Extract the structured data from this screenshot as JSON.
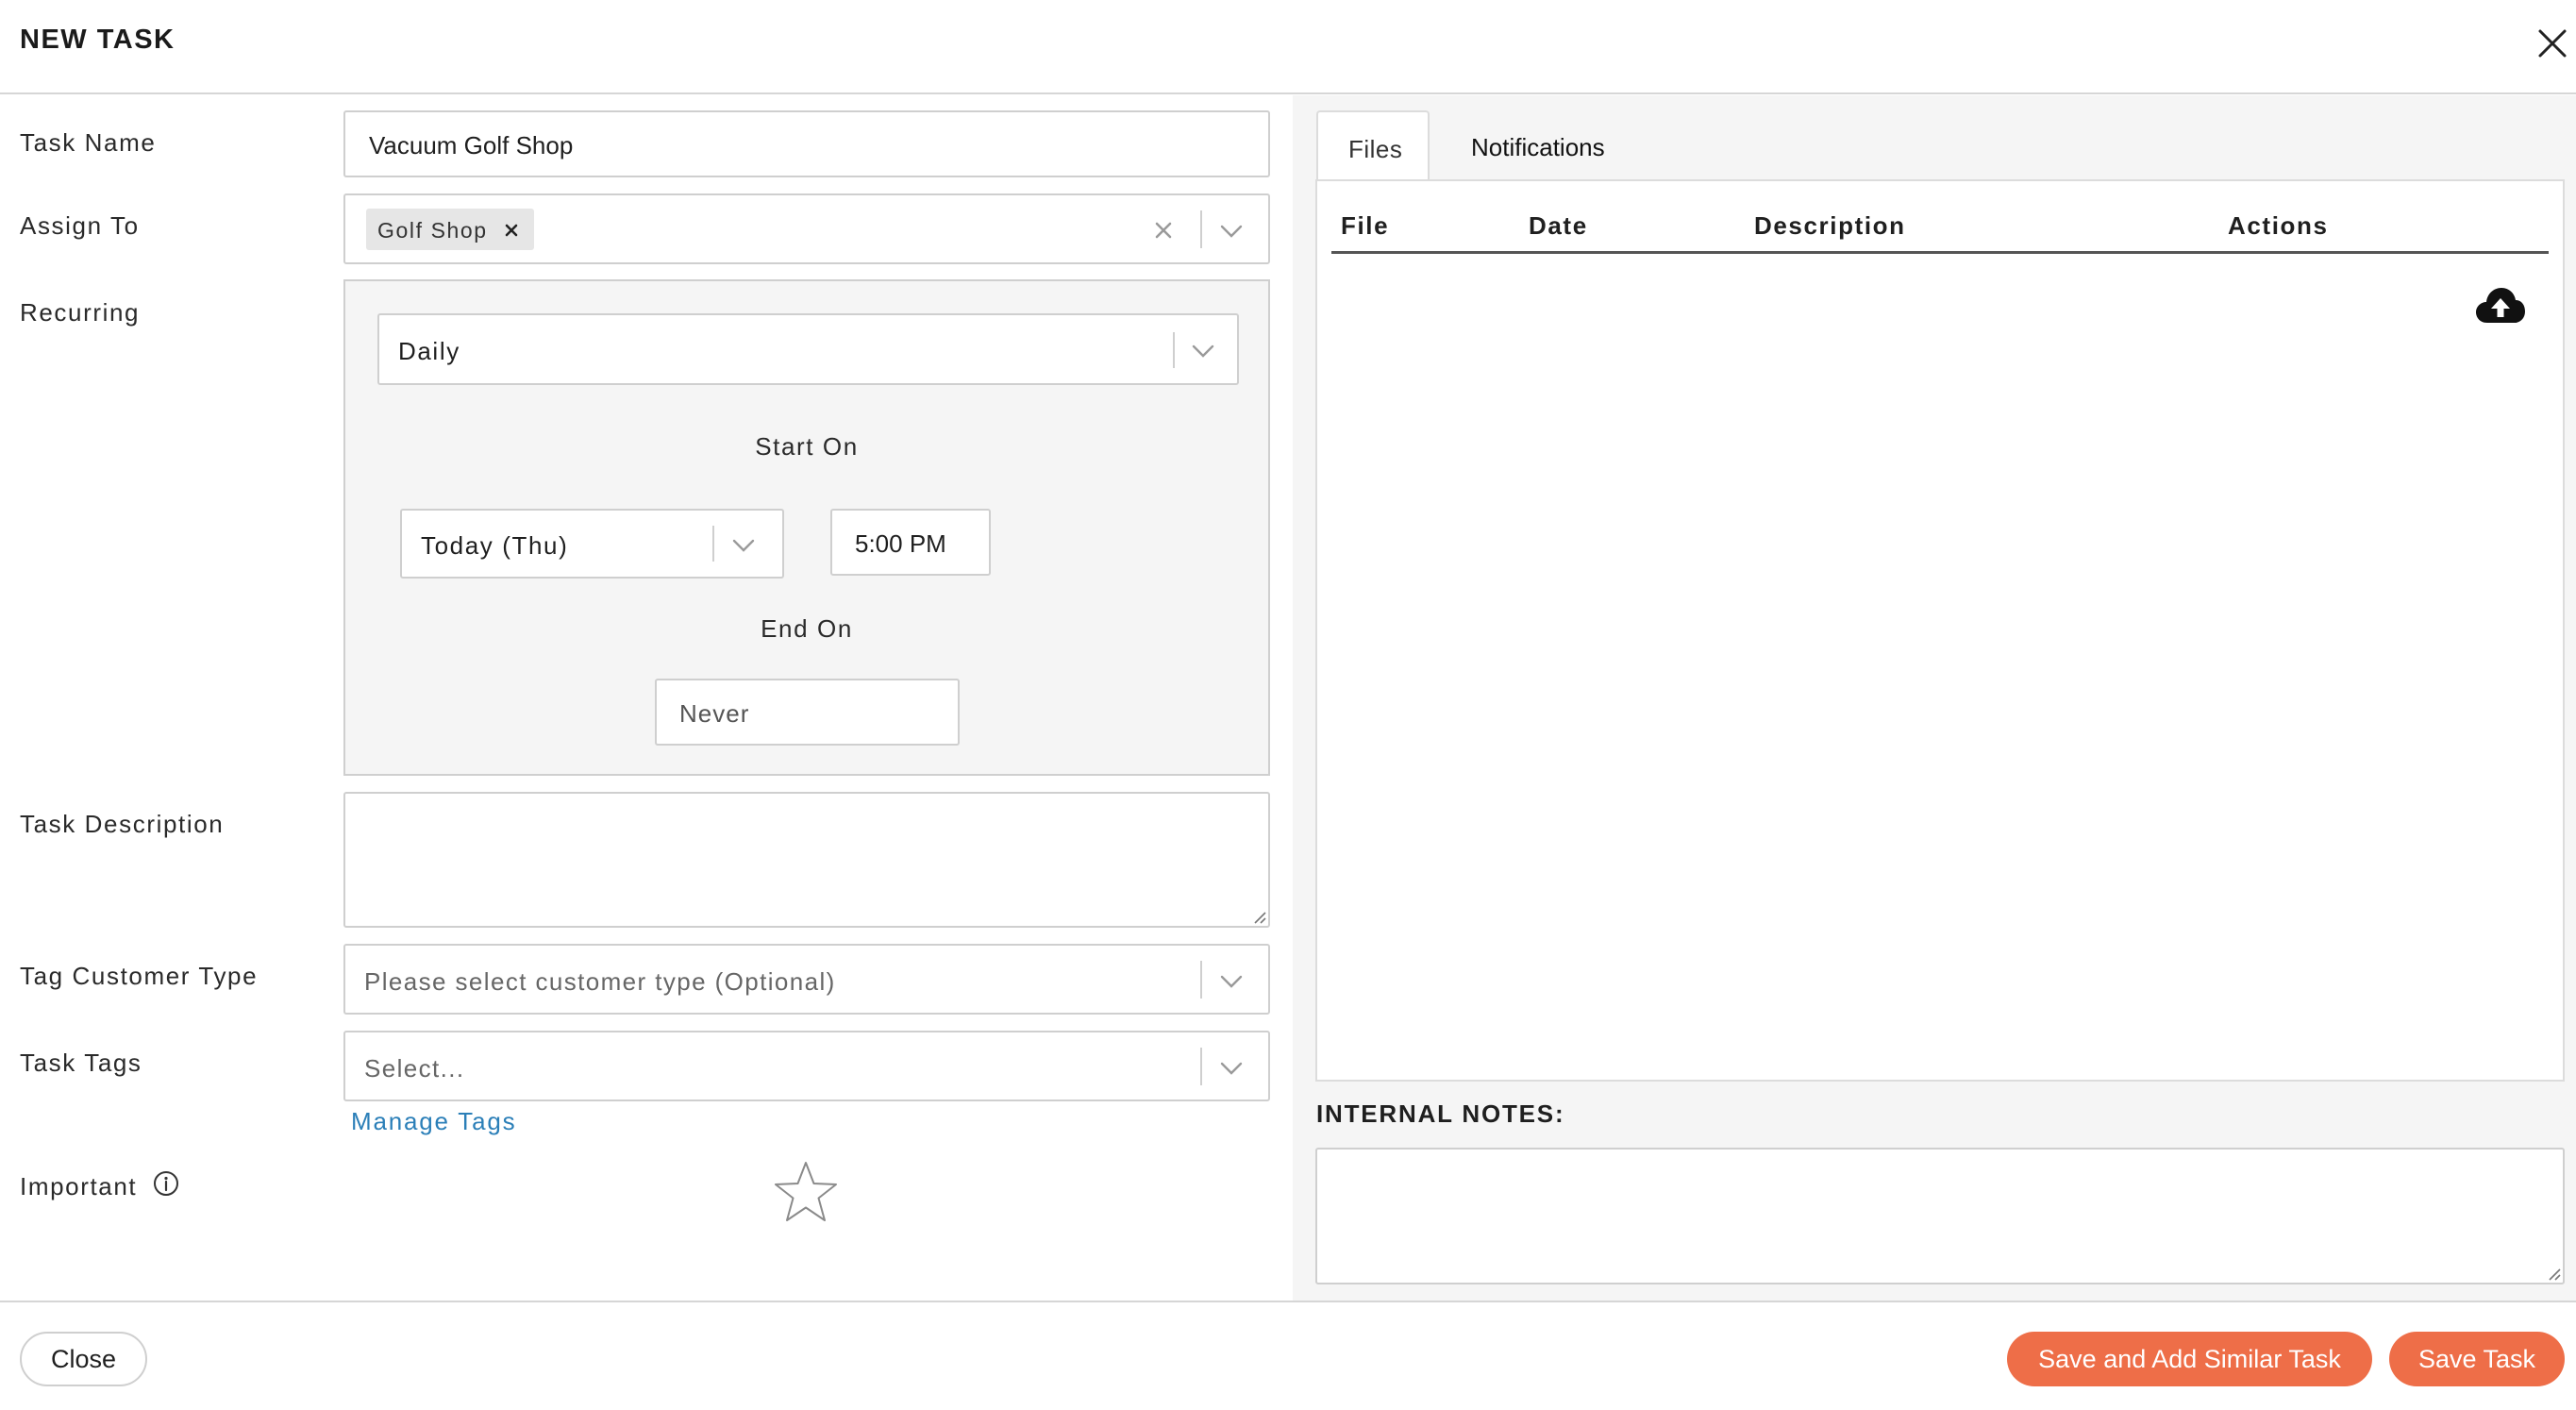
{
  "header": {
    "title": "NEW TASK"
  },
  "form": {
    "task_name": {
      "label": "Task Name",
      "value": "Vacuum Golf Shop"
    },
    "assign_to": {
      "label": "Assign To",
      "chip": "Golf Shop"
    },
    "recurring": {
      "label": "Recurring",
      "frequency": "Daily",
      "start_on_label": "Start On",
      "start_day": "Today (Thu)",
      "start_time": "5:00 PM",
      "end_on_label": "End On",
      "end_value": "Never"
    },
    "task_description": {
      "label": "Task Description"
    },
    "customer_type": {
      "label": "Tag Customer Type",
      "placeholder": "Please select customer type (Optional)"
    },
    "task_tags": {
      "label": "Task Tags",
      "placeholder": "Select...",
      "manage_link": "Manage Tags"
    },
    "important": {
      "label": "Important"
    }
  },
  "right": {
    "tabs": [
      {
        "label": "Files"
      },
      {
        "label": "Notifications"
      }
    ],
    "files_table": {
      "columns": [
        "File",
        "Date",
        "Description",
        "Actions"
      ]
    },
    "internal_notes_label": "INTERNAL NOTES:"
  },
  "footer": {
    "close_label": "Close",
    "save_similar_label": "Save and Add Similar Task",
    "save_label": "Save Task"
  },
  "colors": {
    "accent": "#ee6e48",
    "link": "#2b7fb8"
  },
  "icons": [
    "close-icon",
    "clear-icon",
    "chevron-down-icon",
    "remove-chip-icon",
    "info-icon",
    "star-icon",
    "cloud-upload-icon",
    "resize-handle-icon"
  ]
}
